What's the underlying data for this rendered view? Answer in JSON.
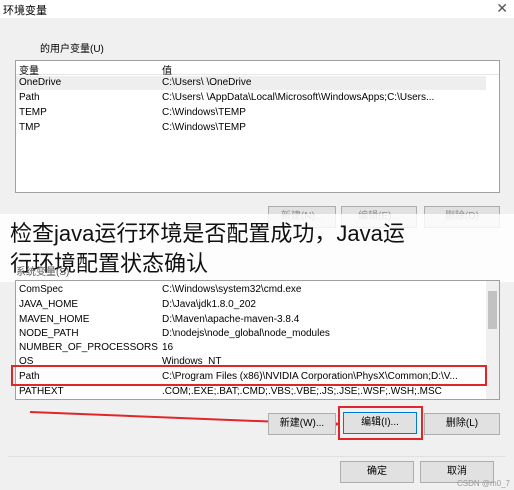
{
  "window": {
    "title": "环境变量",
    "close_glyph": "✕"
  },
  "user_vars": {
    "label": "的用户变量(U)",
    "header": {
      "name": "变量",
      "value": "值"
    },
    "rows": [
      {
        "name": "OneDrive",
        "value": "C:\\Users\\          \\OneDrive"
      },
      {
        "name": "Path",
        "value": "C:\\Users\\          \\AppData\\Local\\Microsoft\\WindowsApps;C:\\Users..."
      },
      {
        "name": "TEMP",
        "value": "C:\\Windows\\TEMP"
      },
      {
        "name": "TMP",
        "value": "C:\\Windows\\TEMP"
      }
    ],
    "buttons": {
      "new": "新建(N)...",
      "edit": "编辑(E)...",
      "delete": "删除(D)"
    }
  },
  "caption": {
    "line1": "检查java运行环境是否配置成功，Java运",
    "line2": "行环境配置状态确认"
  },
  "system_vars": {
    "label": "系统变量(S)",
    "rows": [
      {
        "name": "ComSpec",
        "value": "C:\\Windows\\system32\\cmd.exe"
      },
      {
        "name": "JAVA_HOME",
        "value": "D:\\Java\\jdk1.8.0_202"
      },
      {
        "name": "MAVEN_HOME",
        "value": "D:\\Maven\\apache-maven-3.8.4"
      },
      {
        "name": "NODE_PATH",
        "value": "D:\\nodejs\\node_global\\node_modules"
      },
      {
        "name": "NUMBER_OF_PROCESSORS",
        "value": "16"
      },
      {
        "name": "OS",
        "value": "Windows_NT"
      },
      {
        "name": "Path",
        "value": "C:\\Program Files (x86)\\NVIDIA Corporation\\PhysX\\Common;D:\\V..."
      },
      {
        "name": "PATHEXT",
        "value": ".COM;.EXE;.BAT;.CMD;.VBS;.VBE;.JS;.JSE;.WSF;.WSH;.MSC"
      }
    ],
    "buttons": {
      "new": "新建(W)...",
      "edit": "编辑(I)...",
      "delete": "删除(L)"
    }
  },
  "footer": {
    "ok": "确定",
    "cancel": "取消"
  },
  "watermark": "CSDN @m0_7"
}
